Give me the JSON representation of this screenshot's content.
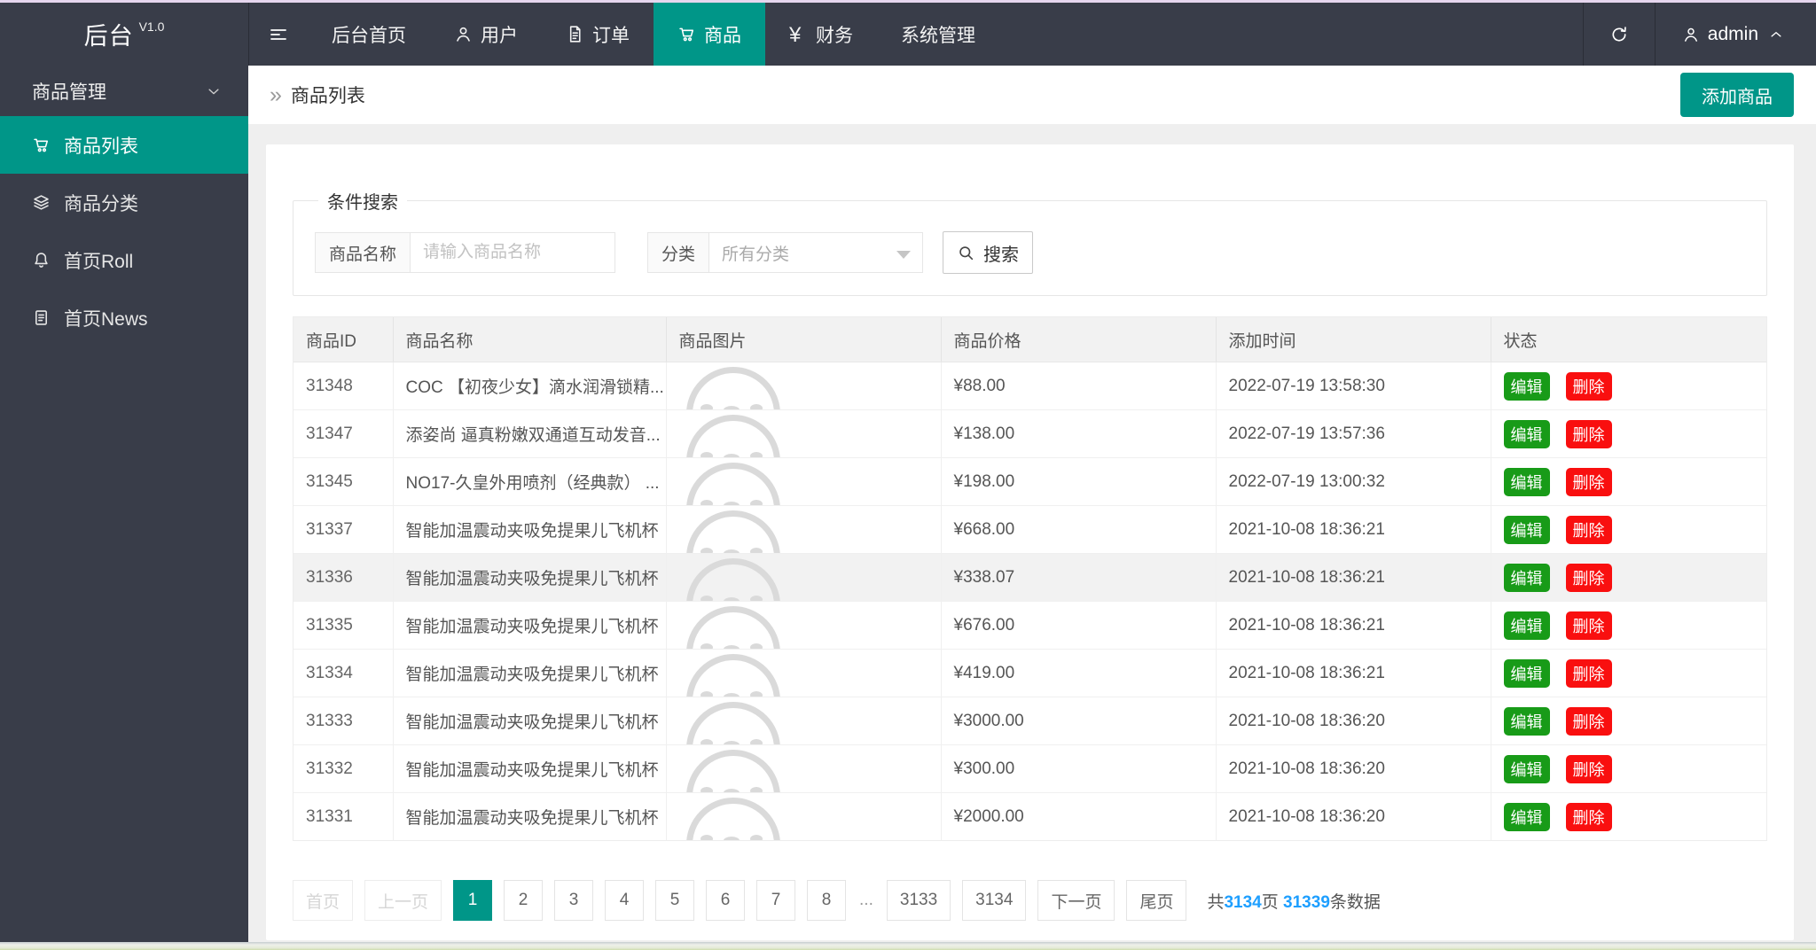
{
  "topbar": {
    "logo": "后台",
    "version": "V1.0",
    "nav": [
      {
        "label": "后台首页",
        "icon": null,
        "active": false
      },
      {
        "label": "用户",
        "icon": "user-icon",
        "active": false
      },
      {
        "label": "订单",
        "icon": "document-icon",
        "active": false
      },
      {
        "label": "商品",
        "icon": "cart-icon",
        "active": true
      },
      {
        "label": "财务",
        "icon": "yen-icon",
        "active": false
      },
      {
        "label": "系统管理",
        "icon": null,
        "active": false
      }
    ],
    "username": "admin"
  },
  "sidebar": {
    "group_label": "商品管理",
    "items": [
      {
        "label": "商品列表",
        "icon": "cart-icon",
        "active": true
      },
      {
        "label": "商品分类",
        "icon": "layers-icon",
        "active": false
      },
      {
        "label": "首页Roll",
        "icon": "bell-icon",
        "active": false
      },
      {
        "label": "首页News",
        "icon": "clipboard-icon",
        "active": false
      }
    ]
  },
  "breadcrumb": {
    "title": "商品列表"
  },
  "toolbar": {
    "add_label": "添加商品"
  },
  "search": {
    "legend": "条件搜索",
    "name_label": "商品名称",
    "name_placeholder": "请输入商品名称",
    "name_value": "",
    "category_label": "分类",
    "category_value": "所有分类",
    "search_label": "搜索"
  },
  "table": {
    "columns": [
      "商品ID",
      "商品名称",
      "商品图片",
      "商品价格",
      "添加时间",
      "状态"
    ],
    "edit_label": "编辑",
    "delete_label": "删除",
    "rows": [
      {
        "id": "31348",
        "name": "COC 【初夜少女】滴水润滑锁精...",
        "price": "¥88.00",
        "time": "2022-07-19 13:58:30",
        "highlight": false
      },
      {
        "id": "31347",
        "name": "添姿尚 逼真粉嫩双通道互动发音...",
        "price": "¥138.00",
        "time": "2022-07-19 13:57:36",
        "highlight": false
      },
      {
        "id": "31345",
        "name": "NO17-久皇外用喷剂（经典款） ...",
        "price": "¥198.00",
        "time": "2022-07-19 13:00:32",
        "highlight": false
      },
      {
        "id": "31337",
        "name": "智能加温震动夹吸免提果儿飞机杯",
        "price": "¥668.00",
        "time": "2021-10-08 18:36:21",
        "highlight": false
      },
      {
        "id": "31336",
        "name": "智能加温震动夹吸免提果儿飞机杯",
        "price": "¥338.07",
        "time": "2021-10-08 18:36:21",
        "highlight": true
      },
      {
        "id": "31335",
        "name": "智能加温震动夹吸免提果儿飞机杯",
        "price": "¥676.00",
        "time": "2021-10-08 18:36:21",
        "highlight": false
      },
      {
        "id": "31334",
        "name": "智能加温震动夹吸免提果儿飞机杯",
        "price": "¥419.00",
        "time": "2021-10-08 18:36:21",
        "highlight": false
      },
      {
        "id": "31333",
        "name": "智能加温震动夹吸免提果儿飞机杯",
        "price": "¥3000.00",
        "time": "2021-10-08 18:36:20",
        "highlight": false
      },
      {
        "id": "31332",
        "name": "智能加温震动夹吸免提果儿飞机杯",
        "price": "¥300.00",
        "time": "2021-10-08 18:36:20",
        "highlight": false
      },
      {
        "id": "31331",
        "name": "智能加温震动夹吸免提果儿飞机杯",
        "price": "¥2000.00",
        "time": "2021-10-08 18:36:20",
        "highlight": false
      }
    ]
  },
  "pagination": {
    "first": "首页",
    "prev": "上一页",
    "pages": [
      "1",
      "2",
      "3",
      "4",
      "5",
      "6",
      "7",
      "8"
    ],
    "active_page": "1",
    "ellipsis": "...",
    "tail_pages": [
      "3133",
      "3134"
    ],
    "next": "下一页",
    "last": "尾页",
    "summary": {
      "prefix": "共",
      "total_pages": "3134",
      "mid": "页 ",
      "total_items": "31339",
      "suffix": "条数据"
    }
  },
  "colors": {
    "accent": "#009688",
    "dark": "#393d49",
    "edit_green": "#189b18",
    "delete_red": "#f90f0f",
    "link_blue": "#1e9fff"
  }
}
